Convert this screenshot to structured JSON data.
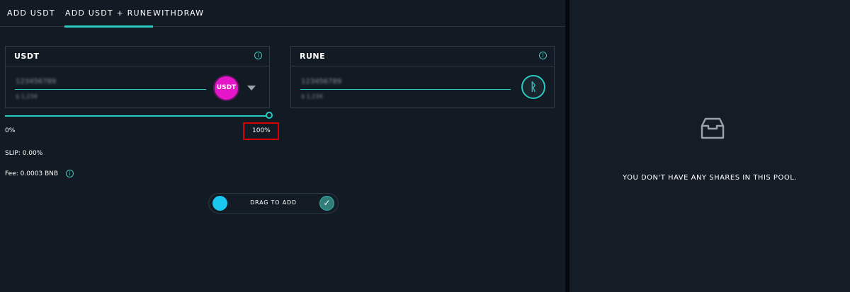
{
  "tabs": [
    {
      "label": "ADD USDT",
      "active": false
    },
    {
      "label": "ADD USDT + RUNE",
      "active": true
    },
    {
      "label": "WITHDRAW",
      "active": false
    }
  ],
  "usdt_panel": {
    "title": "USDT",
    "info_icon": "i",
    "amount_blurred": "123456789",
    "sub_blurred": "$ 1,234",
    "token_symbol": "USDT"
  },
  "rune_panel": {
    "title": "RUNE",
    "info_icon": "i",
    "amount_blurred": "123456789",
    "sub_blurred": "$ 1,234",
    "token_symbol": "ᚱ"
  },
  "slider": {
    "min_label": "0%",
    "value_label": "100%",
    "value_fraction": 1.0
  },
  "slip": "SLIP: 0.00%",
  "fee": "Fee: 0.0003 BNB",
  "fee_info_icon": "i",
  "drag_button": {
    "label": "DRAG TO ADD",
    "check": "✓"
  },
  "right_panel": {
    "empty_message": "YOU DON'T HAVE ANY SHARES IN THIS POOL.",
    "icon": "inbox-icon"
  },
  "colors": {
    "accent": "#28c9c0",
    "usdt_token": "#e515c8",
    "drag_handle": "#19c7f0",
    "highlight": "#d50000"
  }
}
